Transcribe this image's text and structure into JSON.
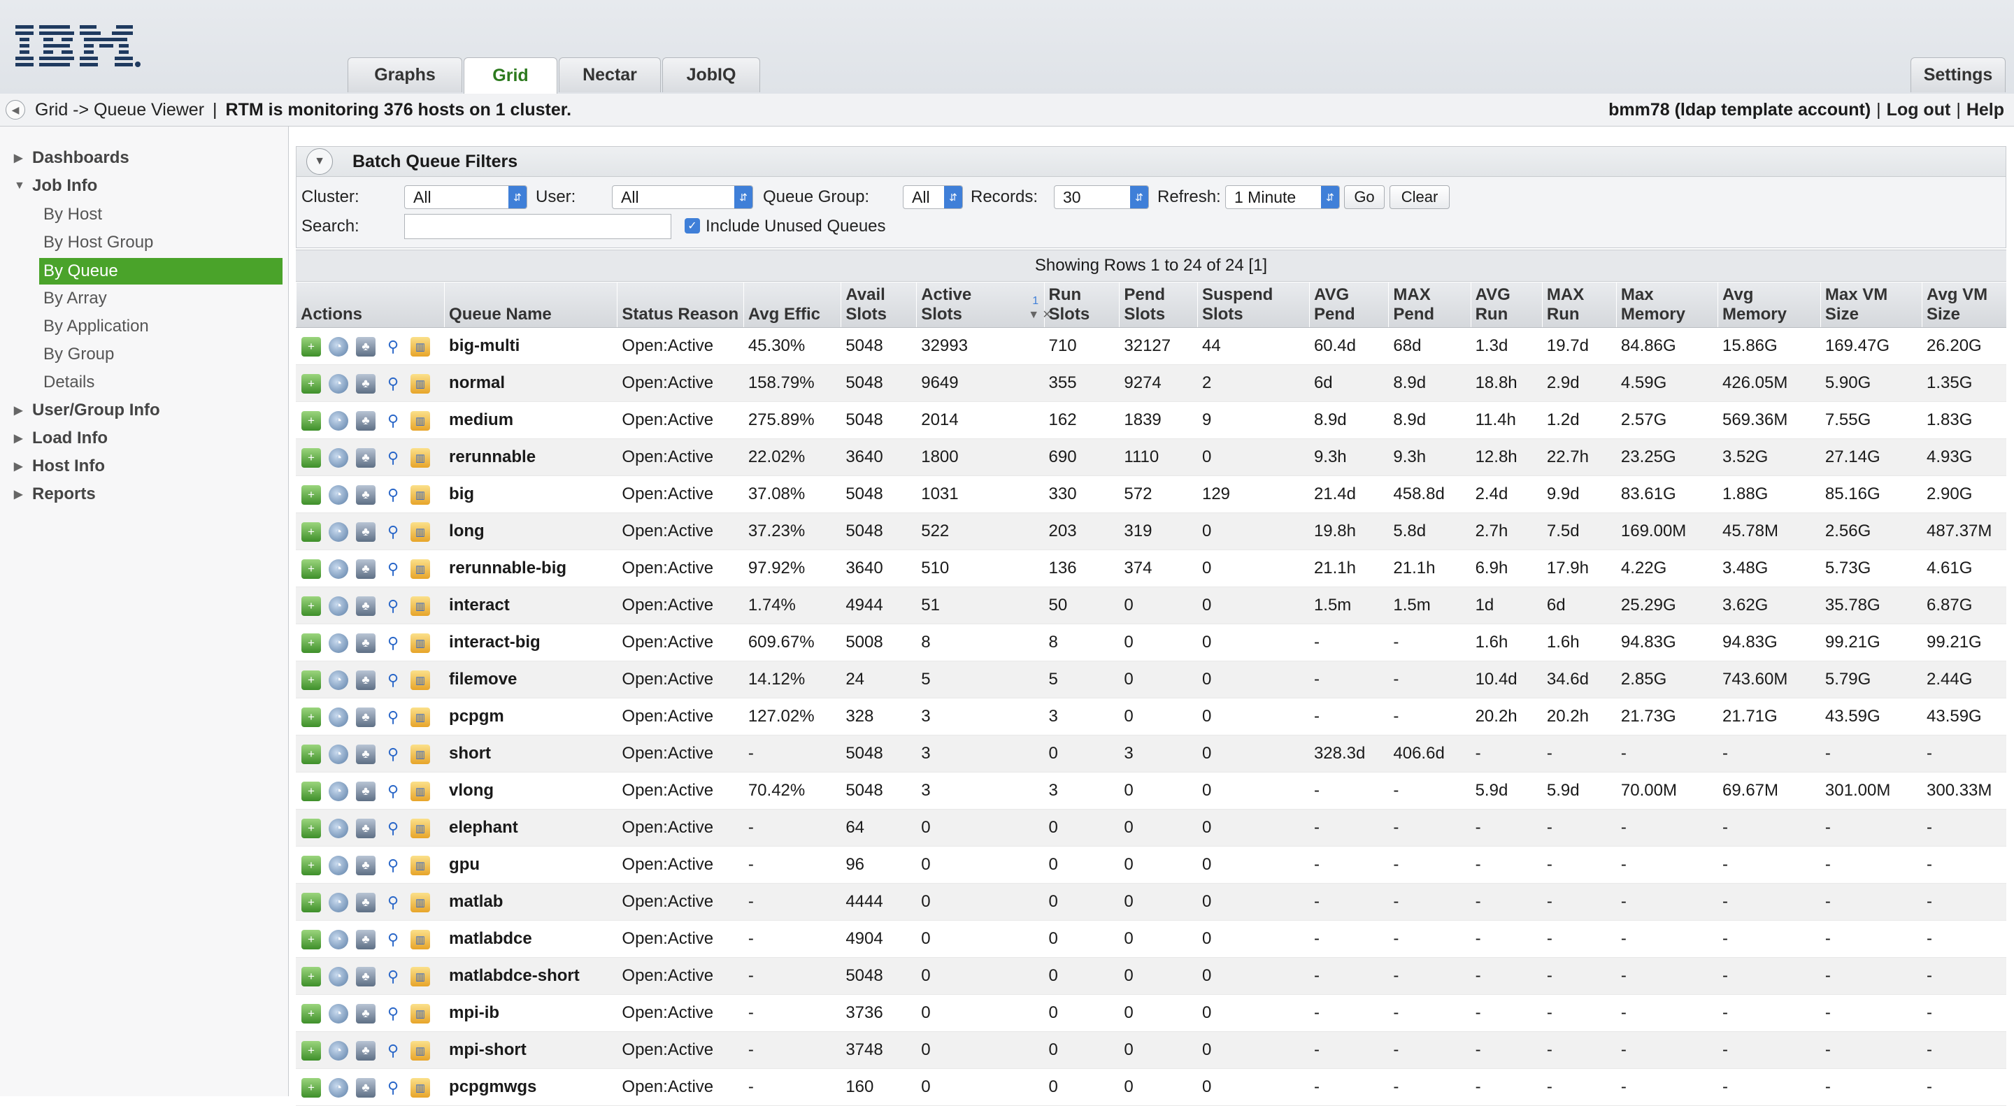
{
  "header": {
    "logo_text": "IBM",
    "tabs": [
      {
        "label": "Graphs",
        "active": false
      },
      {
        "label": "Grid",
        "active": true
      },
      {
        "label": "Nectar",
        "active": false
      },
      {
        "label": "JobIQ",
        "active": false
      }
    ],
    "settings_label": "Settings"
  },
  "breadcrumb": {
    "path": "Grid -> Queue Viewer",
    "separator": "|",
    "status": "RTM is monitoring 376 hosts on 1 cluster.",
    "user": "bmm78 (ldap template account)",
    "logout": "Log out",
    "help": "Help",
    "link_sep": "|"
  },
  "sidebar": {
    "dashboards": "Dashboards",
    "job_info": "Job Info",
    "job_info_items": [
      "By Host",
      "By Host Group",
      "By Queue",
      "By Array",
      "By Application",
      "By Group",
      "Details"
    ],
    "active_item": "By Queue",
    "user_group_info": "User/Group Info",
    "load_info": "Load Info",
    "host_info": "Host Info",
    "reports": "Reports"
  },
  "filters": {
    "title": "Batch Queue Filters",
    "cluster_label": "Cluster:",
    "cluster_value": "All",
    "user_label": "User:",
    "user_value": "All",
    "queue_group_label": "Queue Group:",
    "queue_group_value": "All",
    "records_label": "Records:",
    "records_value": "30",
    "refresh_label": "Refresh:",
    "refresh_value": "1 Minute",
    "go_label": "Go",
    "clear_label": "Clear",
    "search_label": "Search:",
    "search_value": "",
    "include_unused_label": "Include Unused Queues",
    "include_unused_checked": true
  },
  "table": {
    "showing": "Showing Rows 1 to 24 of 24 [1]",
    "sort_marker": "1",
    "columns": [
      "Actions",
      "Queue Name",
      "Status Reason",
      "Avg Effic",
      "Avail\nSlots",
      "Active\nSlots",
      "Run\nSlots",
      "Pend\nSlots",
      "Suspend\nSlots",
      "AVG\nPend",
      "MAX\nPend",
      "AVG\nRun",
      "MAX\nRun",
      "Max\nMemory",
      "Avg\nMemory",
      "Max VM\nSize",
      "Avg VM\nSize"
    ],
    "rows": [
      [
        "big-multi",
        "Open:Active",
        "45.30%",
        "5048",
        "32993",
        "710",
        "32127",
        "44",
        "60.4d",
        "68d",
        "1.3d",
        "19.7d",
        "84.86G",
        "15.86G",
        "169.47G",
        "26.20G"
      ],
      [
        "normal",
        "Open:Active",
        "158.79%",
        "5048",
        "9649",
        "355",
        "9274",
        "2",
        "6d",
        "8.9d",
        "18.8h",
        "2.9d",
        "4.59G",
        "426.05M",
        "5.90G",
        "1.35G"
      ],
      [
        "medium",
        "Open:Active",
        "275.89%",
        "5048",
        "2014",
        "162",
        "1839",
        "9",
        "8.9d",
        "8.9d",
        "11.4h",
        "1.2d",
        "2.57G",
        "569.36M",
        "7.55G",
        "1.83G"
      ],
      [
        "rerunnable",
        "Open:Active",
        "22.02%",
        "3640",
        "1800",
        "690",
        "1110",
        "0",
        "9.3h",
        "9.3h",
        "12.8h",
        "22.7h",
        "23.25G",
        "3.52G",
        "27.14G",
        "4.93G"
      ],
      [
        "big",
        "Open:Active",
        "37.08%",
        "5048",
        "1031",
        "330",
        "572",
        "129",
        "21.4d",
        "458.8d",
        "2.4d",
        "9.9d",
        "83.61G",
        "1.88G",
        "85.16G",
        "2.90G"
      ],
      [
        "long",
        "Open:Active",
        "37.23%",
        "5048",
        "522",
        "203",
        "319",
        "0",
        "19.8h",
        "5.8d",
        "2.7h",
        "7.5d",
        "169.00M",
        "45.78M",
        "2.56G",
        "487.37M"
      ],
      [
        "rerunnable-big",
        "Open:Active",
        "97.92%",
        "3640",
        "510",
        "136",
        "374",
        "0",
        "21.1h",
        "21.1h",
        "6.9h",
        "17.9h",
        "4.22G",
        "3.48G",
        "5.73G",
        "4.61G"
      ],
      [
        "interact",
        "Open:Active",
        "1.74%",
        "4944",
        "51",
        "50",
        "0",
        "0",
        "1.5m",
        "1.5m",
        "1d",
        "6d",
        "25.29G",
        "3.62G",
        "35.78G",
        "6.87G"
      ],
      [
        "interact-big",
        "Open:Active",
        "609.67%",
        "5008",
        "8",
        "8",
        "0",
        "0",
        "-",
        "-",
        "1.6h",
        "1.6h",
        "94.83G",
        "94.83G",
        "99.21G",
        "99.21G"
      ],
      [
        "filemove",
        "Open:Active",
        "14.12%",
        "24",
        "5",
        "5",
        "0",
        "0",
        "-",
        "-",
        "10.4d",
        "34.6d",
        "2.85G",
        "743.60M",
        "5.79G",
        "2.44G"
      ],
      [
        "pcpgm",
        "Open:Active",
        "127.02%",
        "328",
        "3",
        "3",
        "0",
        "0",
        "-",
        "-",
        "20.2h",
        "20.2h",
        "21.73G",
        "21.71G",
        "43.59G",
        "43.59G"
      ],
      [
        "short",
        "Open:Active",
        "-",
        "5048",
        "3",
        "0",
        "3",
        "0",
        "328.3d",
        "406.6d",
        "-",
        "-",
        "-",
        "-",
        "-",
        "-"
      ],
      [
        "vlong",
        "Open:Active",
        "70.42%",
        "5048",
        "3",
        "3",
        "0",
        "0",
        "-",
        "-",
        "5.9d",
        "5.9d",
        "70.00M",
        "69.67M",
        "301.00M",
        "300.33M"
      ],
      [
        "elephant",
        "Open:Active",
        "-",
        "64",
        "0",
        "0",
        "0",
        "0",
        "-",
        "-",
        "-",
        "-",
        "-",
        "-",
        "-",
        "-"
      ],
      [
        "gpu",
        "Open:Active",
        "-",
        "96",
        "0",
        "0",
        "0",
        "0",
        "-",
        "-",
        "-",
        "-",
        "-",
        "-",
        "-",
        "-"
      ],
      [
        "matlab",
        "Open:Active",
        "-",
        "4444",
        "0",
        "0",
        "0",
        "0",
        "-",
        "-",
        "-",
        "-",
        "-",
        "-",
        "-",
        "-"
      ],
      [
        "matlabdce",
        "Open:Active",
        "-",
        "4904",
        "0",
        "0",
        "0",
        "0",
        "-",
        "-",
        "-",
        "-",
        "-",
        "-",
        "-",
        "-"
      ],
      [
        "matlabdce-short",
        "Open:Active",
        "-",
        "5048",
        "0",
        "0",
        "0",
        "0",
        "-",
        "-",
        "-",
        "-",
        "-",
        "-",
        "-",
        "-"
      ],
      [
        "mpi-ib",
        "Open:Active",
        "-",
        "3736",
        "0",
        "0",
        "0",
        "0",
        "-",
        "-",
        "-",
        "-",
        "-",
        "-",
        "-",
        "-"
      ],
      [
        "mpi-short",
        "Open:Active",
        "-",
        "3748",
        "0",
        "0",
        "0",
        "0",
        "-",
        "-",
        "-",
        "-",
        "-",
        "-",
        "-",
        "-"
      ],
      [
        "pcpgmwgs",
        "Open:Active",
        "-",
        "160",
        "0",
        "0",
        "0",
        "0",
        "-",
        "-",
        "-",
        "-",
        "-",
        "-",
        "-",
        "-"
      ]
    ]
  }
}
